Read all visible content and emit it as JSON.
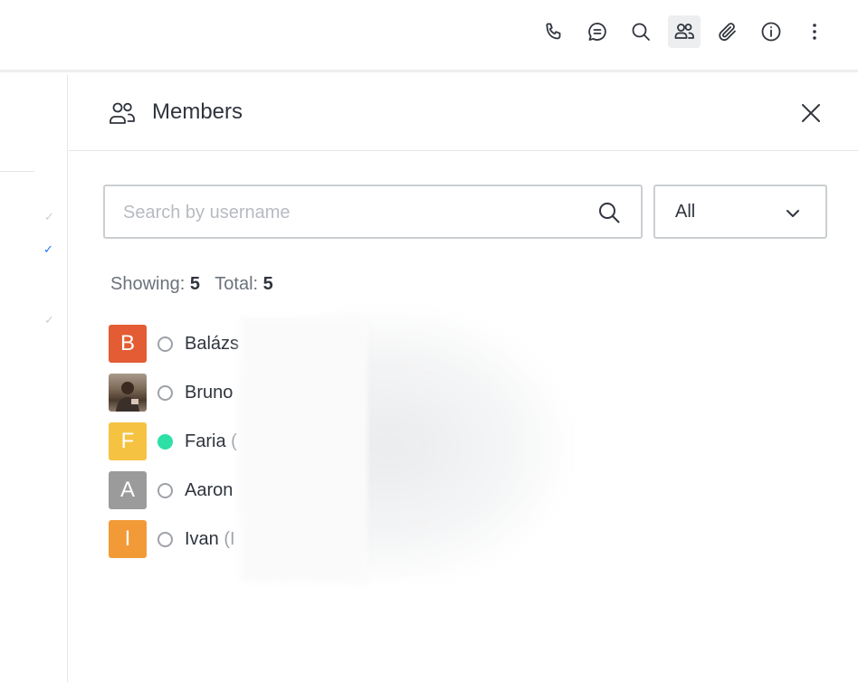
{
  "toolbar": {
    "icons": [
      "phone-icon",
      "discussion-icon",
      "search-icon",
      "members-icon",
      "attachment-icon",
      "info-icon",
      "kebab-menu-icon"
    ],
    "active": "members-icon"
  },
  "panel": {
    "title": "Members",
    "search_placeholder": "Search by username",
    "filter_value": "All",
    "showing_label": "Showing:",
    "showing_count": "5",
    "total_label": "Total:",
    "total_count": "5"
  },
  "members": [
    {
      "initial": "B",
      "name": "Balázs",
      "suffix": "",
      "status": "offline",
      "avatar_color": "#e35c33",
      "photo": false
    },
    {
      "initial": "",
      "name": "Bruno",
      "suffix": "",
      "status": "offline",
      "avatar_color": "#6b5a48",
      "photo": true
    },
    {
      "initial": "F",
      "name": "Faria",
      "suffix": "(",
      "status": "online",
      "avatar_color": "#f5c242",
      "photo": false
    },
    {
      "initial": "A",
      "name": "Aaron",
      "suffix": "",
      "status": "offline",
      "avatar_color": "#9b9b9b",
      "photo": false
    },
    {
      "initial": "I",
      "name": "Ivan",
      "suffix": "(I",
      "status": "offline",
      "avatar_color": "#f29a38",
      "photo": false
    }
  ],
  "colors": {
    "text": "#2f343d",
    "muted": "#6c727a",
    "border": "#cbced1",
    "online": "#2de0a5",
    "offline": "#9ea2a8",
    "check_read": "#1d74f5"
  }
}
